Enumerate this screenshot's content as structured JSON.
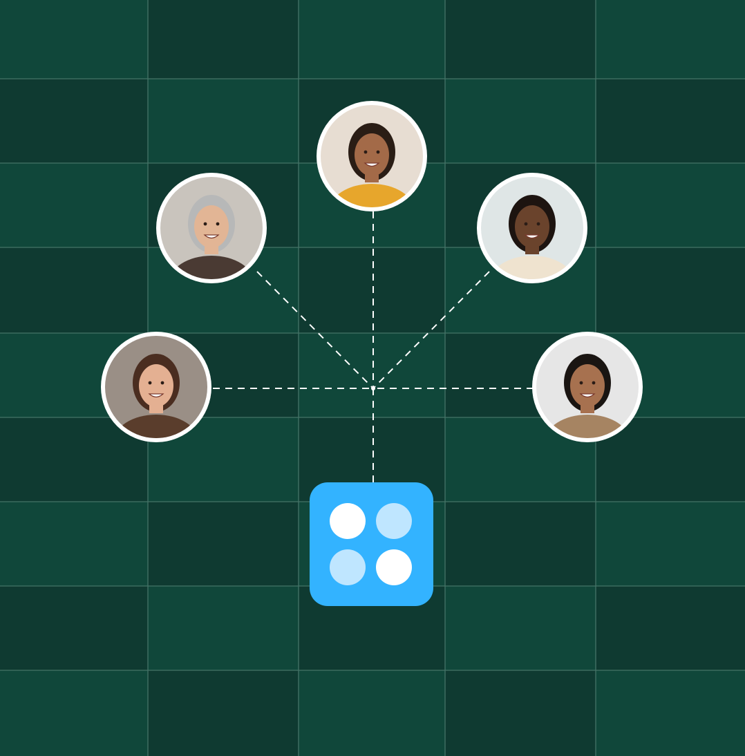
{
  "colors": {
    "background_dark": "#0f3a31",
    "background_light": "#10473a",
    "grid_line": "#4f7d71",
    "connector": "#ffffff",
    "avatar_ring": "#ffffff",
    "tile": "#33b3ff",
    "dot_solid": "#ffffff",
    "dot_light": "#bfe6ff"
  },
  "avatars": [
    {
      "name": "avatar-gray-haired-woman",
      "hair": "#b7b8b8",
      "skin": "#e2b595",
      "shirt": "#4a3a33",
      "bg": "#c9c4bd"
    },
    {
      "name": "avatar-woman-hair-bun",
      "hair": "#2a1d15",
      "skin": "#a36a48",
      "shirt": "#e7a62c",
      "bg": "#e7ddd2"
    },
    {
      "name": "avatar-bearded-man",
      "hair": "#1d1410",
      "skin": "#6a432c",
      "shirt": "#efe3cf",
      "bg": "#dfe6e6"
    },
    {
      "name": "avatar-smiling-woman",
      "hair": "#4a2d20",
      "skin": "#e4b092",
      "shirt": "#5a3d2c",
      "bg": "#9a8f86"
    },
    {
      "name": "avatar-man-glasses",
      "hair": "#1a1512",
      "skin": "#a7714f",
      "shirt": "#a68462",
      "bg": "#e6e6e6"
    }
  ],
  "app_icon": {
    "name": "app-grid-icon",
    "dots": [
      "solid",
      "light",
      "light",
      "solid"
    ]
  }
}
